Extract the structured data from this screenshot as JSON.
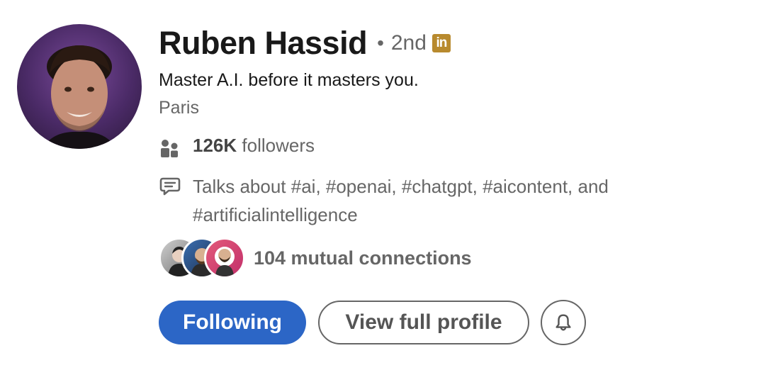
{
  "profile": {
    "name": "Ruben Hassid",
    "separator": "•",
    "degree": "2nd",
    "badge": "in",
    "headline": "Master A.I. before it masters you.",
    "location": "Paris"
  },
  "stats": {
    "followers_count": "126K",
    "followers_label": " followers",
    "talks_about": "Talks about #ai, #openai, #chatgpt, #aicontent, and #artificialintelligence"
  },
  "mutual": {
    "label": "104 mutual connections"
  },
  "actions": {
    "following_label": "Following",
    "view_profile_label": "View full profile"
  },
  "icons": {
    "followers": "people-icon",
    "talks": "speech-bubble-icon",
    "bell": "bell-icon",
    "linkedin": "linkedin-icon"
  },
  "colors": {
    "primary_button": "#2c66c6",
    "linkedin_badge": "#b88a2e",
    "secondary_text": "#666666"
  }
}
